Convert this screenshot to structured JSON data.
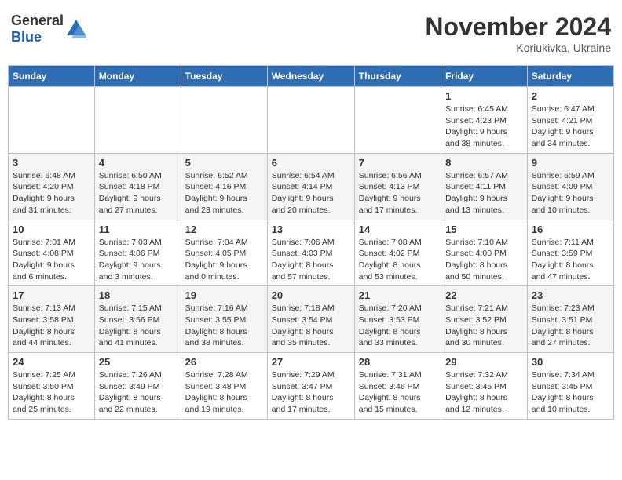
{
  "header": {
    "logo_general": "General",
    "logo_blue": "Blue",
    "month": "November 2024",
    "location": "Koriukivka, Ukraine"
  },
  "weekdays": [
    "Sunday",
    "Monday",
    "Tuesday",
    "Wednesday",
    "Thursday",
    "Friday",
    "Saturday"
  ],
  "weeks": [
    [
      {
        "day": "",
        "info": ""
      },
      {
        "day": "",
        "info": ""
      },
      {
        "day": "",
        "info": ""
      },
      {
        "day": "",
        "info": ""
      },
      {
        "day": "",
        "info": ""
      },
      {
        "day": "1",
        "info": "Sunrise: 6:45 AM\nSunset: 4:23 PM\nDaylight: 9 hours\nand 38 minutes."
      },
      {
        "day": "2",
        "info": "Sunrise: 6:47 AM\nSunset: 4:21 PM\nDaylight: 9 hours\nand 34 minutes."
      }
    ],
    [
      {
        "day": "3",
        "info": "Sunrise: 6:48 AM\nSunset: 4:20 PM\nDaylight: 9 hours\nand 31 minutes."
      },
      {
        "day": "4",
        "info": "Sunrise: 6:50 AM\nSunset: 4:18 PM\nDaylight: 9 hours\nand 27 minutes."
      },
      {
        "day": "5",
        "info": "Sunrise: 6:52 AM\nSunset: 4:16 PM\nDaylight: 9 hours\nand 23 minutes."
      },
      {
        "day": "6",
        "info": "Sunrise: 6:54 AM\nSunset: 4:14 PM\nDaylight: 9 hours\nand 20 minutes."
      },
      {
        "day": "7",
        "info": "Sunrise: 6:56 AM\nSunset: 4:13 PM\nDaylight: 9 hours\nand 17 minutes."
      },
      {
        "day": "8",
        "info": "Sunrise: 6:57 AM\nSunset: 4:11 PM\nDaylight: 9 hours\nand 13 minutes."
      },
      {
        "day": "9",
        "info": "Sunrise: 6:59 AM\nSunset: 4:09 PM\nDaylight: 9 hours\nand 10 minutes."
      }
    ],
    [
      {
        "day": "10",
        "info": "Sunrise: 7:01 AM\nSunset: 4:08 PM\nDaylight: 9 hours\nand 6 minutes."
      },
      {
        "day": "11",
        "info": "Sunrise: 7:03 AM\nSunset: 4:06 PM\nDaylight: 9 hours\nand 3 minutes."
      },
      {
        "day": "12",
        "info": "Sunrise: 7:04 AM\nSunset: 4:05 PM\nDaylight: 9 hours\nand 0 minutes."
      },
      {
        "day": "13",
        "info": "Sunrise: 7:06 AM\nSunset: 4:03 PM\nDaylight: 8 hours\nand 57 minutes."
      },
      {
        "day": "14",
        "info": "Sunrise: 7:08 AM\nSunset: 4:02 PM\nDaylight: 8 hours\nand 53 minutes."
      },
      {
        "day": "15",
        "info": "Sunrise: 7:10 AM\nSunset: 4:00 PM\nDaylight: 8 hours\nand 50 minutes."
      },
      {
        "day": "16",
        "info": "Sunrise: 7:11 AM\nSunset: 3:59 PM\nDaylight: 8 hours\nand 47 minutes."
      }
    ],
    [
      {
        "day": "17",
        "info": "Sunrise: 7:13 AM\nSunset: 3:58 PM\nDaylight: 8 hours\nand 44 minutes."
      },
      {
        "day": "18",
        "info": "Sunrise: 7:15 AM\nSunset: 3:56 PM\nDaylight: 8 hours\nand 41 minutes."
      },
      {
        "day": "19",
        "info": "Sunrise: 7:16 AM\nSunset: 3:55 PM\nDaylight: 8 hours\nand 38 minutes."
      },
      {
        "day": "20",
        "info": "Sunrise: 7:18 AM\nSunset: 3:54 PM\nDaylight: 8 hours\nand 35 minutes."
      },
      {
        "day": "21",
        "info": "Sunrise: 7:20 AM\nSunset: 3:53 PM\nDaylight: 8 hours\nand 33 minutes."
      },
      {
        "day": "22",
        "info": "Sunrise: 7:21 AM\nSunset: 3:52 PM\nDaylight: 8 hours\nand 30 minutes."
      },
      {
        "day": "23",
        "info": "Sunrise: 7:23 AM\nSunset: 3:51 PM\nDaylight: 8 hours\nand 27 minutes."
      }
    ],
    [
      {
        "day": "24",
        "info": "Sunrise: 7:25 AM\nSunset: 3:50 PM\nDaylight: 8 hours\nand 25 minutes."
      },
      {
        "day": "25",
        "info": "Sunrise: 7:26 AM\nSunset: 3:49 PM\nDaylight: 8 hours\nand 22 minutes."
      },
      {
        "day": "26",
        "info": "Sunrise: 7:28 AM\nSunset: 3:48 PM\nDaylight: 8 hours\nand 19 minutes."
      },
      {
        "day": "27",
        "info": "Sunrise: 7:29 AM\nSunset: 3:47 PM\nDaylight: 8 hours\nand 17 minutes."
      },
      {
        "day": "28",
        "info": "Sunrise: 7:31 AM\nSunset: 3:46 PM\nDaylight: 8 hours\nand 15 minutes."
      },
      {
        "day": "29",
        "info": "Sunrise: 7:32 AM\nSunset: 3:45 PM\nDaylight: 8 hours\nand 12 minutes."
      },
      {
        "day": "30",
        "info": "Sunrise: 7:34 AM\nSunset: 3:45 PM\nDaylight: 8 hours\nand 10 minutes."
      }
    ]
  ]
}
